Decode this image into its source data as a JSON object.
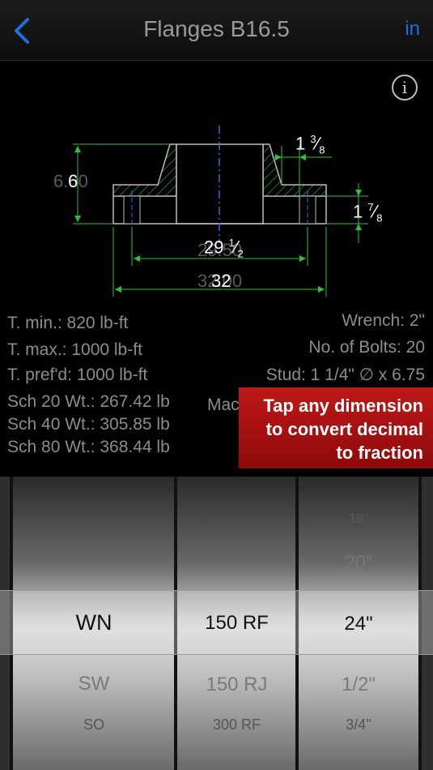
{
  "nav": {
    "title": "Flanges B16.5",
    "right_label": "in"
  },
  "info": {
    "label": "i"
  },
  "drawing": {
    "dim_height": "6",
    "ghost_height": "6.00",
    "dim_hub": "1",
    "dim_hub_frac_num": "3",
    "dim_hub_frac_den": "8",
    "dim_thick": "1",
    "dim_thick_frac_num": "7",
    "dim_thick_frac_den": "8",
    "dim_bolt": "29",
    "dim_bolt_frac_num": "1",
    "dim_bolt_frac_den": "2",
    "dim_od": "32",
    "ghost_od": "32.00",
    "ghost_bolt": "29.50"
  },
  "specs": {
    "t_min": "T. min.:  820 lb-ft",
    "t_max": "T. max.: 1000 lb-ft",
    "t_pref": "T. pref'd: 1000 lb-ft",
    "sch20": "Sch 20 Wt.: 267.42 lb",
    "sch40": "Sch 40 Wt.: 305.85 lb",
    "sch80": "Sch 80 Wt.: 368.44 lb",
    "wrench": "Wrench: 2\"",
    "bolts": "No. of Bolts: 20",
    "stud": "Stud: 1 1/4\" ∅ x 6.75",
    "mach": "Mach"
  },
  "tooltip": {
    "line1": "Tap any dimension",
    "line2": "to convert decimal",
    "line3": "to fraction"
  },
  "picker": {
    "col1": {
      "selected": "WN",
      "below1": "SW",
      "below2": "SO"
    },
    "col2": {
      "selected": "150 RF",
      "below1": "150 RJ",
      "below2": "300 RF"
    },
    "col3": {
      "above2": "18\"",
      "above1": "20\"",
      "selected": "24\"",
      "below1": "1/2\"",
      "below2": "3/4\""
    }
  },
  "colors": {
    "accent": "#1d6fe0",
    "tooltip": "#b01212",
    "line": "#2fbf3f"
  }
}
